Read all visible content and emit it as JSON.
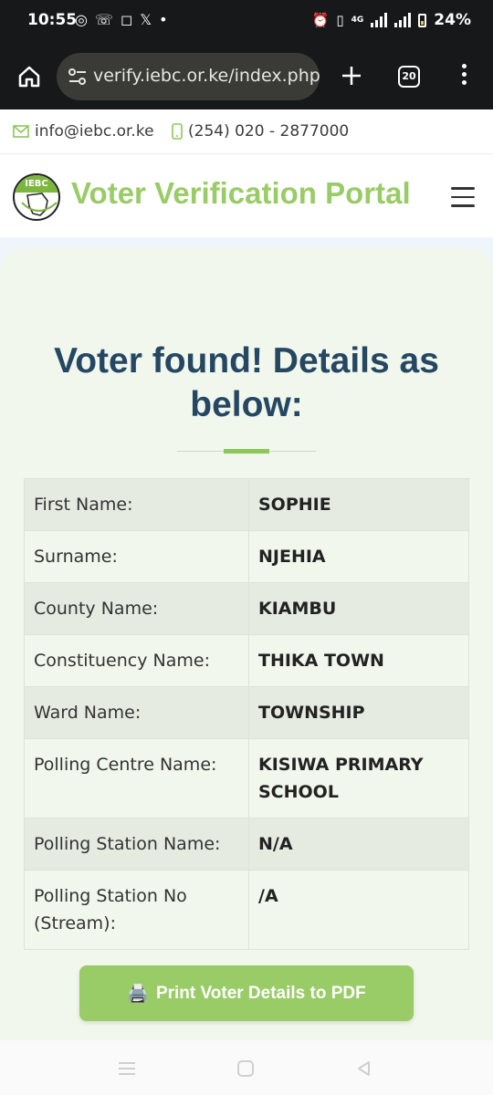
{
  "status_bar": {
    "time": "10:55",
    "battery_percent": "24%",
    "network": "4G"
  },
  "browser": {
    "url": "verify.iebc.or.ke/index.php",
    "tab_count": "20"
  },
  "contact": {
    "email": "info@iebc.or.ke",
    "phone": "(254) 020 - 2877000"
  },
  "header": {
    "logo_text": "IEBC",
    "title": "Voter Verification Portal"
  },
  "main": {
    "heading": "Voter found! Details as below:",
    "details": [
      {
        "label": "First Name:",
        "value": "SOPHIE"
      },
      {
        "label": "Surname:",
        "value": "NJEHIA"
      },
      {
        "label": "County Name:",
        "value": "KIAMBU"
      },
      {
        "label": "Constituency Name:",
        "value": "THIKA TOWN"
      },
      {
        "label": "Ward Name:",
        "value": "TOWNSHIP"
      },
      {
        "label": "Polling Centre Name:",
        "value": "KISIWA PRIMARY SCHOOL"
      },
      {
        "label": "Polling Station Name:",
        "value": "N/A"
      },
      {
        "label": "Polling Station No (Stream):",
        "value": "/A"
      }
    ],
    "print_button": {
      "icon": "🖨️",
      "label": "Print Voter Details to PDF"
    }
  },
  "colors": {
    "brand_green": "#99cc66",
    "heading_navy": "#254763",
    "card_background": "#f1f7ec"
  }
}
